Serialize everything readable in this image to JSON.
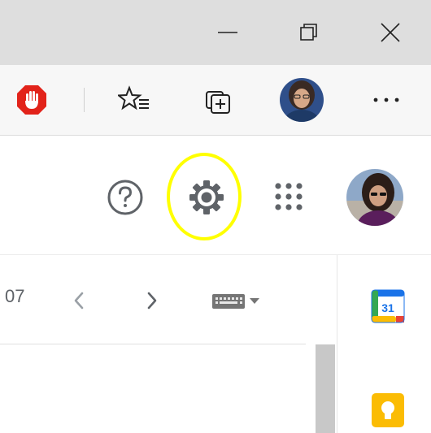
{
  "window": {
    "minimize_icon": "minimize-icon",
    "restore_icon": "restore-icon",
    "close_icon": "close-icon"
  },
  "browser_toolbar": {
    "extension_icon": "adblock-hand-icon",
    "favorites_icon": "favorites-icon",
    "collections_icon": "collections-icon",
    "profile": "profile-avatar",
    "more_icon": "more-dots-icon"
  },
  "gmail_header": {
    "help_icon": "help-icon",
    "settings_icon": "settings-gear-icon",
    "apps_icon": "apps-grid-icon",
    "account_avatar": "account-avatar",
    "highlight_color": "#ffff00"
  },
  "mail_toolbar": {
    "page_count": "07",
    "prev_icon": "chevron-left-icon",
    "next_icon": "chevron-right-icon",
    "input_tools_icon": "keyboard-icon",
    "input_tools_dropdown": "caret-down-icon"
  },
  "side_panel": {
    "calendar_label": "31",
    "calendar_icon": "google-calendar-icon",
    "keep_icon": "google-keep-icon"
  }
}
